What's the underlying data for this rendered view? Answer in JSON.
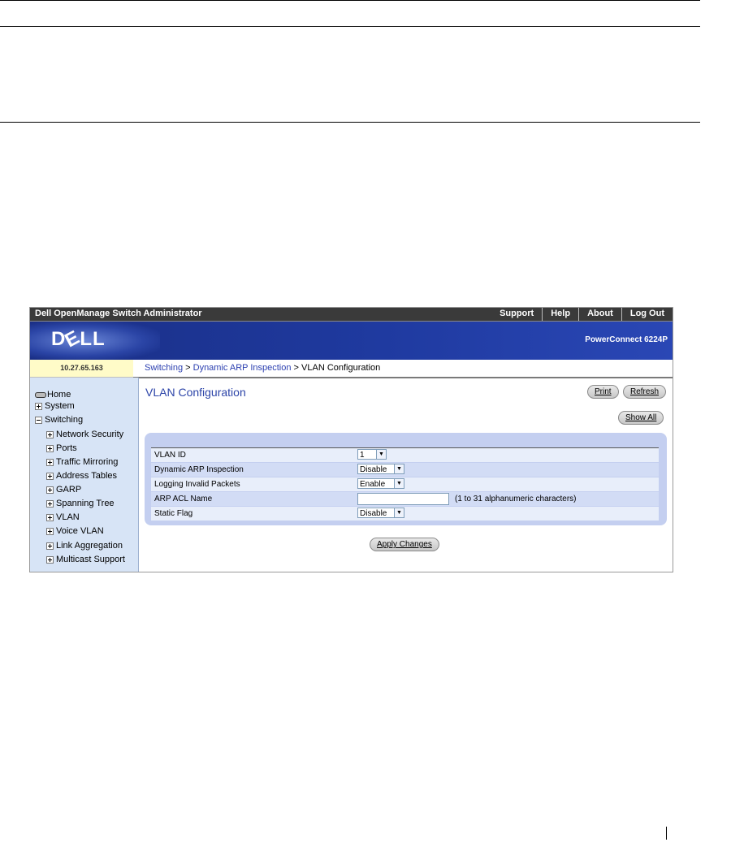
{
  "app_title": "Dell OpenManage Switch Administrator",
  "top_links": [
    "Support",
    "Help",
    "About",
    "Log Out"
  ],
  "brand": {
    "logo": "DELL",
    "logo_pre": "D",
    "logo_e": "E",
    "logo_post": "LL",
    "product": "PowerConnect 6224P"
  },
  "ip_address": "10.27.65.163",
  "breadcrumb": {
    "item1": "Switching",
    "sep": " > ",
    "item2": "Dynamic ARP Inspection",
    "current": "VLAN Configuration"
  },
  "sidebar": {
    "home": "Home",
    "system": "System",
    "switching": "Switching",
    "children": [
      "Network Security",
      "Ports",
      "Traffic Mirroring",
      "Address Tables",
      "GARP",
      "Spanning Tree",
      "VLAN",
      "Voice VLAN",
      "Link Aggregation",
      "Multicast Support"
    ]
  },
  "page": {
    "title": "VLAN Configuration",
    "print_label": "Print",
    "refresh_label": "Refresh",
    "show_all_label": "Show All",
    "apply_label": "Apply Changes"
  },
  "form": {
    "vlan_id_label": "VLAN ID",
    "vlan_id_value": "1",
    "dai_label": "Dynamic ARP Inspection",
    "dai_value": "Disable",
    "logging_label": "Logging Invalid Packets",
    "logging_value": "Enable",
    "acl_label": "ARP ACL Name",
    "acl_value": "",
    "acl_hint": "(1 to 31 alphanumeric characters)",
    "static_label": "Static Flag",
    "static_value": "Disable"
  },
  "icons": {
    "expand": "plus-box-icon",
    "collapse": "minus-box-icon",
    "dropdown": "chevron-down-icon",
    "home": "home-icon"
  }
}
